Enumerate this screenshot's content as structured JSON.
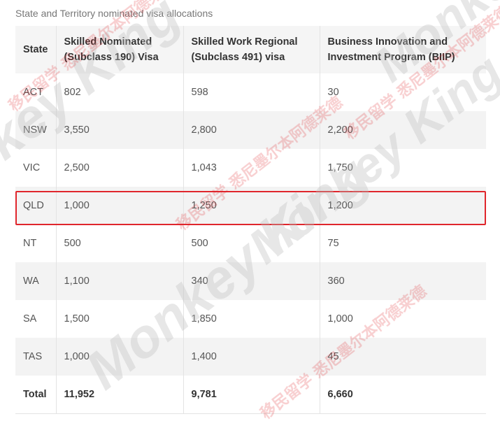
{
  "caption": "State and Territory nominated visa allocations",
  "table": {
    "headers": [
      "State",
      "Skilled Nominated (Subclass 190) Visa",
      "Skilled Work Regional (Subclass 491) visa",
      "Business Innovation and Investment Program (BIIP)"
    ],
    "rows": [
      [
        "ACT",
        "802",
        "598",
        "30"
      ],
      [
        "NSW",
        "3,550",
        "2,800",
        "2,200"
      ],
      [
        "VIC",
        "2,500",
        "1,043",
        "1,750"
      ],
      [
        "QLD",
        "1,000",
        "1,250",
        "1,200"
      ],
      [
        "NT",
        "500",
        "500",
        "75"
      ],
      [
        "WA",
        "1,100",
        "340",
        "360"
      ],
      [
        "SA",
        "1,500",
        "1,850",
        "1,000"
      ],
      [
        "TAS",
        "1,000",
        "1,400",
        "45"
      ],
      [
        "Total",
        "11,952",
        "9,781",
        "6,660"
      ]
    ],
    "highlighted_row": "QLD"
  },
  "watermark": {
    "text": "Monkey King",
    "cjk": "移民留学 悉尼墨尔本阿德莱德",
    "color": "#c0c0c0",
    "accent": "#e0262c"
  },
  "highlight_color": "#e0262c"
}
